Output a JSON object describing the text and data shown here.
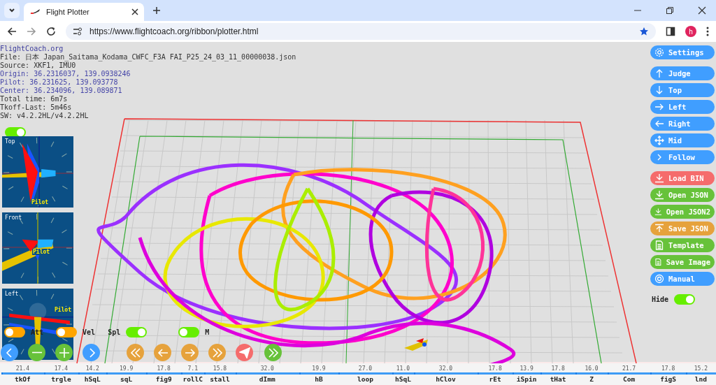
{
  "browser": {
    "tab_title": "Flight Plotter",
    "url": "https://www.flightcoach.org/ribbon/plotter.html",
    "profile_initial": "h"
  },
  "info": {
    "site": "FlightCoach.org",
    "lines": [
      {
        "text": "File: 日本 Japan_Saitama_Kodama_CWFC_F3A FAI_P25_24_03_11_00000038.json",
        "kind": "plain"
      },
      {
        "text": "Source: XKF1, IMU0",
        "kind": "plain"
      },
      {
        "text": "Origin: 36.2316037, 139.0938246",
        "kind": "coordinate"
      },
      {
        "text": "Pilot: 36.231625, 139.093778",
        "kind": "coordinate"
      },
      {
        "text": "Center: 36.234096, 139.089871",
        "kind": "coordinate"
      },
      {
        "text": "Total time: 6m7s",
        "kind": "plain"
      },
      {
        "text": "Tkoff-Last: 5m46s",
        "kind": "plain"
      },
      {
        "text": "SW: v4.2.2HL/v4.2.2HL",
        "kind": "plain"
      }
    ]
  },
  "info_toggle": {
    "on": true
  },
  "views": [
    {
      "label": "Top",
      "pilot_label": "Pilot",
      "kind": "top"
    },
    {
      "label": "Front",
      "pilot_label": "Pilot",
      "kind": "front"
    },
    {
      "label": "Left",
      "pilot_label": "Pilot",
      "kind": "left"
    }
  ],
  "toggles": [
    {
      "label": "Att",
      "on": false,
      "color": "#ffa500",
      "kind": "label-after"
    },
    {
      "label": "Vel",
      "on": false,
      "color": "#ffa500",
      "kind": "label-after"
    },
    {
      "label": "Spl",
      "on": true,
      "color": "#66ee00",
      "kind": "label-before"
    },
    {
      "label": "M",
      "on": false,
      "color": "#66ee00",
      "kind": "label-after"
    }
  ],
  "playback_buttons": [
    {
      "kind": "chevron-left",
      "color": "#409eff"
    },
    {
      "kind": "minus",
      "color": "#67c23a"
    },
    {
      "kind": "plus",
      "color": "#67c23a"
    },
    {
      "kind": "chevron-right",
      "color": "#409eff"
    },
    {
      "kind": "double-left",
      "color": "#e6a23c"
    },
    {
      "kind": "arrow-left",
      "color": "#e6a23c"
    },
    {
      "kind": "arrow-right",
      "color": "#e6a23c"
    },
    {
      "kind": "double-right",
      "color": "#e6a23c"
    },
    {
      "kind": "send",
      "color": "#f56c6c"
    },
    {
      "kind": "double-right",
      "color": "#67c23a"
    }
  ],
  "side_button_groups": [
    [
      {
        "label": "Settings",
        "kind": "gear",
        "color": "#409eff"
      }
    ],
    [
      {
        "label": "Judge",
        "kind": "arrow-up",
        "color": "#409eff"
      },
      {
        "label": "Top",
        "kind": "arrow-down",
        "color": "#409eff"
      },
      {
        "label": "Left",
        "kind": "arrow-right",
        "color": "#409eff"
      },
      {
        "label": "Right",
        "kind": "arrow-left",
        "color": "#409eff"
      },
      {
        "label": "Mid",
        "kind": "move",
        "color": "#409eff"
      },
      {
        "label": "Follow",
        "kind": "chevron",
        "color": "#409eff"
      }
    ],
    [
      {
        "label": "Load BIN",
        "kind": "download",
        "color": "#f56c6c"
      },
      {
        "label": "Open JSON",
        "kind": "download",
        "color": "#67c23a"
      },
      {
        "label": "Open JSON2",
        "kind": "download",
        "color": "#67c23a"
      },
      {
        "label": "Save JSON",
        "kind": "upload",
        "color": "#e6a23c"
      },
      {
        "label": "Template",
        "kind": "document",
        "color": "#67c23a"
      },
      {
        "label": "Save Image",
        "kind": "document",
        "color": "#67c23a"
      },
      {
        "label": "Manual",
        "kind": "lifebuoy",
        "color": "#409eff"
      }
    ]
  ],
  "hide_toggle": {
    "label": "Hide",
    "on": true
  },
  "timeline": [
    {
      "duration": "21.4",
      "name": "tkOf"
    },
    {
      "duration": "17.4",
      "name": "trgle"
    },
    {
      "duration": "14.2",
      "name": "hSqL"
    },
    {
      "duration": "19.9",
      "name": "sqL"
    },
    {
      "duration": "17.8",
      "name": "fig9"
    },
    {
      "duration": "7.1",
      "name": "rollC"
    },
    {
      "duration": "15.8",
      "name": "stall"
    },
    {
      "duration": "32.0",
      "name": "dImm"
    },
    {
      "duration": "19.9",
      "name": "hB"
    },
    {
      "duration": "27.0",
      "name": "loop"
    },
    {
      "duration": "11.0",
      "name": "hSqL"
    },
    {
      "duration": "32.0",
      "name": "hClov"
    },
    {
      "duration": "17.8",
      "name": "rEt"
    },
    {
      "duration": "13.9",
      "name": "iSpin"
    },
    {
      "duration": "17.8",
      "name": "tHat"
    },
    {
      "duration": "16.0",
      "name": "Z"
    },
    {
      "duration": "21.7",
      "name": "Com"
    },
    {
      "duration": "17.8",
      "name": "figS"
    },
    {
      "duration": "15.2",
      "name": "lnd"
    }
  ]
}
